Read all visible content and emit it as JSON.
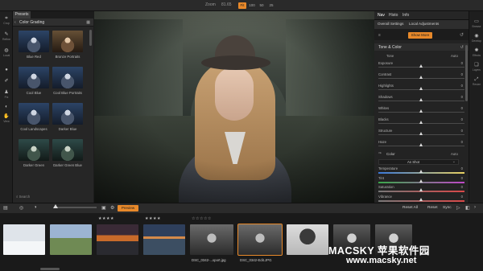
{
  "topbar": {
    "zoom_label": "Zoom",
    "zoom_value": "81.65",
    "zoom_buttons": [
      "Fit",
      "100",
      "50",
      "25"
    ]
  },
  "left_tools": [
    {
      "icon": "crop-icon",
      "label": "Crop"
    },
    {
      "icon": "layers-icon",
      "label": "Refine"
    },
    {
      "icon": "local-icon",
      "label": "Local"
    },
    {
      "icon": "brush-icon",
      "label": ""
    },
    {
      "icon": "pen-icon",
      "label": ""
    },
    {
      "icon": "person-icon",
      "label": "Fix"
    },
    {
      "icon": "view-icon",
      "label": ""
    },
    {
      "icon": "hand-icon",
      "label": "View"
    }
  ],
  "presets": {
    "tab": "Presets",
    "header": "Color Grading",
    "items": [
      {
        "label": "Blue Red",
        "tone": "cool"
      },
      {
        "label": "Bronze Portraits",
        "tone": "warm"
      },
      {
        "label": "Cool Blue",
        "tone": "cool"
      },
      {
        "label": "Cool Blue Portraits",
        "tone": "cool"
      },
      {
        "label": "Cool Landscapes",
        "tone": "cool"
      },
      {
        "label": "Darker Blue",
        "tone": "cool"
      },
      {
        "label": "Darker Green",
        "tone": "green"
      },
      {
        "label": "Darker Green Blue",
        "tone": "green"
      }
    ],
    "search_placeholder": "Search"
  },
  "right_panel": {
    "top_tabs": [
      "Nav",
      "Histo",
      "Info"
    ],
    "adj_tabs": [
      "Overall Settings",
      "Local Adjustments"
    ],
    "show_more": "Show More",
    "tone_color": {
      "title": "Tone & Color",
      "tone_label": "Tone",
      "auto": "Auto",
      "sliders": [
        {
          "label": "Exposure",
          "value": "0",
          "pos": 0.5
        },
        {
          "label": "Contrast",
          "value": "0",
          "pos": 0.5
        },
        {
          "label": "Highlights",
          "value": "0",
          "pos": 0.5
        },
        {
          "label": "Shadows",
          "value": "0",
          "pos": 0.5
        },
        {
          "label": "Whites",
          "value": "0",
          "pos": 0.5
        },
        {
          "label": "Blacks",
          "value": "0",
          "pos": 0.5
        },
        {
          "label": "Structure",
          "value": "0",
          "pos": 0.5
        },
        {
          "label": "Haze",
          "value": "0",
          "pos": 0.5
        }
      ]
    },
    "color": {
      "label": "Color",
      "auto": "Auto",
      "white_balance": "As Shot",
      "sliders": [
        {
          "label": "Temperature",
          "value": "0",
          "pos": 0.5,
          "grad": "#3a78d8,#e8d060"
        },
        {
          "label": "Tint",
          "value": "0",
          "pos": 0.5,
          "grad": "#3aa84a,#c048c8"
        },
        {
          "label": "Saturation",
          "value": "0",
          "pos": 0.5,
          "grad": "#777777,#d84848"
        },
        {
          "label": "Vibrance",
          "value": "0",
          "pos": 0.5,
          "grad": "#777777,#d84848"
        }
      ]
    }
  },
  "right_tools": [
    {
      "icon": "browse-icon",
      "label": "Browse"
    },
    {
      "icon": "develop-icon",
      "label": "Develop"
    },
    {
      "icon": "effects-icon",
      "label": "Effects"
    },
    {
      "icon": "layers-icon",
      "label": "Layers"
    },
    {
      "icon": "resize-icon",
      "label": "Resize"
    }
  ],
  "film_bar": {
    "preview": "Preview",
    "reset_all": "Reset All",
    "reset": "Reset",
    "sync": "Sync"
  },
  "filmstrip": [
    {
      "tone": "snow",
      "stars": "",
      "label": ""
    },
    {
      "tone": "field",
      "stars": "",
      "label": ""
    },
    {
      "tone": "sunset",
      "stars": "★★★★",
      "label": ""
    },
    {
      "tone": "seascape",
      "stars": "★★★★",
      "label": ""
    },
    {
      "tone": "portrait",
      "stars": "☆☆☆☆☆",
      "label": "DSC_0342-...xport.jpg"
    },
    {
      "tone": "portrait",
      "stars": "",
      "label": "DSC_0342-Edit.JPG",
      "selected": true
    },
    {
      "tone": "tree",
      "stars": "",
      "label": ""
    },
    {
      "tone": "bw",
      "stars": "",
      "label": ""
    },
    {
      "tone": "bw",
      "stars": "",
      "label": ""
    }
  ],
  "watermark": {
    "line1": "MACSKY 苹果软件园",
    "line2": "www.macsky.net"
  },
  "colors": {
    "accent": "#e8892a",
    "panel": "#232323",
    "dark": "#1a1a1a"
  }
}
